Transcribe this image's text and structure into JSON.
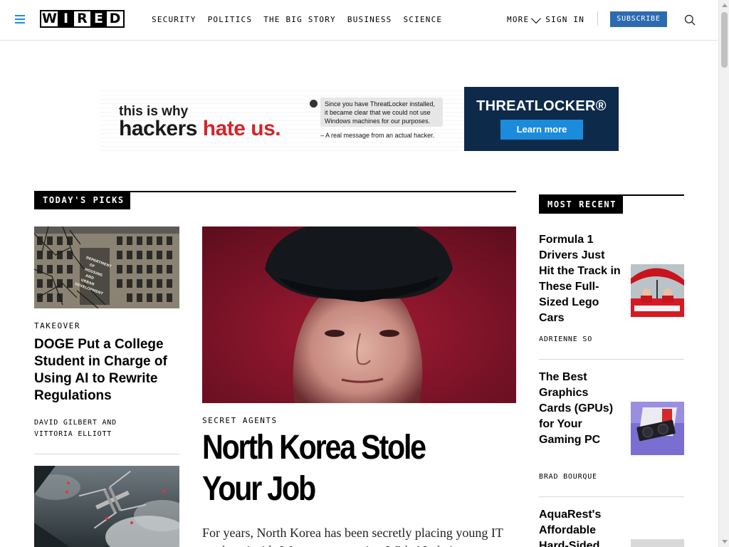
{
  "nav": {
    "brand": [
      "W",
      "I",
      "R",
      "E",
      "D"
    ],
    "links": [
      "SECURITY",
      "POLITICS",
      "THE BIG STORY",
      "BUSINESS",
      "SCIENCE"
    ],
    "more": "MORE",
    "sign_in": "SIGN IN",
    "subscribe": "SUBSCRIBE",
    "accent_color": "#1a8fd8",
    "subscribe_color": "#2d6bb0"
  },
  "ad": {
    "line1": "this is why",
    "line2_a": "hackers ",
    "line2_b": "hate us.",
    "bubble": "Since you have ThreatLocker installed, it became clear that we could not use Windows machines for our purposes.",
    "quote": "– A real message from an actual hacker.",
    "brand": "THREATLOCKER®",
    "cta": "Learn more"
  },
  "picks": {
    "header": "TODAY'S PICKS",
    "stories": [
      {
        "kicker": "TAKEOVER",
        "title": "DOGE Put a College Student in Charge of Using AI to Rewrite Regulations",
        "byline_1": "DAVID GILBERT AND",
        "byline_2": "VITTORIA ELLIOTT"
      }
    ],
    "hud_sign": "DEPARTMENT OF HOUSING AND URBAN DEVELOPMENT"
  },
  "hero": {
    "kicker": "SECRET AGENTS",
    "title": "North Korea Stole Your Job",
    "dek": "For years, North Korea has been secretly placing young IT workers inside Western companies. With AI, their"
  },
  "recent": {
    "header": "MOST RECENT",
    "items": [
      {
        "title": "Formula 1 Drivers Just Hit the Track in These Full-Sized Lego Cars",
        "byline": "ADRIENNE SO"
      },
      {
        "title": "The Best Graphics Cards (GPUs) for Your Gaming PC",
        "byline": "BRAD BOURQUE"
      },
      {
        "title": "AquaRest's Affordable Hard-Sided",
        "byline": ""
      }
    ]
  }
}
